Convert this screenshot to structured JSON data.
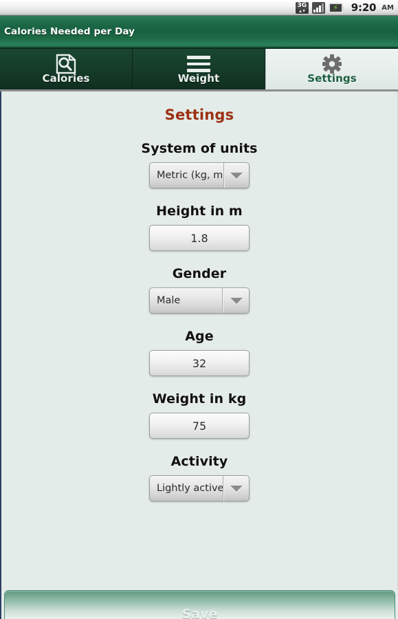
{
  "status_bar": {
    "network_label": "3G",
    "network_icon": "signal-3g-icon",
    "signal_icon": "signal-bars-icon",
    "battery_icon": "battery-charging-icon",
    "battery_glyph": "⚡",
    "time": "9:20",
    "meridiem": "AM"
  },
  "title_bar": {
    "app_title": "Calories Needed per Day"
  },
  "tabs": [
    {
      "label": "Calories",
      "icon": "document-search-icon",
      "active": false
    },
    {
      "label": "Weight",
      "icon": "list-lines-icon",
      "active": false
    },
    {
      "label": "Settings",
      "icon": "gear-icon",
      "active": true
    }
  ],
  "main": {
    "page_title": "Settings",
    "fields": [
      {
        "label": "System of units",
        "type": "spinner",
        "value": "Metric (kg, m)",
        "arrow_icon": "chevron-down-icon"
      },
      {
        "label": "Height in m",
        "type": "input",
        "value": "1.8",
        "placeholder": "1.8"
      },
      {
        "label": "Gender",
        "type": "spinner",
        "value": "Male",
        "arrow_icon": "chevron-down-icon"
      },
      {
        "label": "Age",
        "type": "input",
        "value": "32",
        "placeholder": "32"
      },
      {
        "label": "Weight in kg",
        "type": "input",
        "value": "75",
        "placeholder": "75"
      },
      {
        "label": "Activity",
        "type": "spinner",
        "value": "Lightly active",
        "arrow_icon": "chevron-down-icon"
      }
    ]
  },
  "footer": {
    "save_label": "Save"
  },
  "colors": {
    "title_bar_green": "#17603f",
    "tab_inactive_green": "#153b28",
    "tab_active_bg": "#e6eeec",
    "page_bg": "#e4ecea",
    "accent_title": "#9c3114",
    "active_tab_text": "#1d5f41",
    "save_green": "#79ab95"
  }
}
